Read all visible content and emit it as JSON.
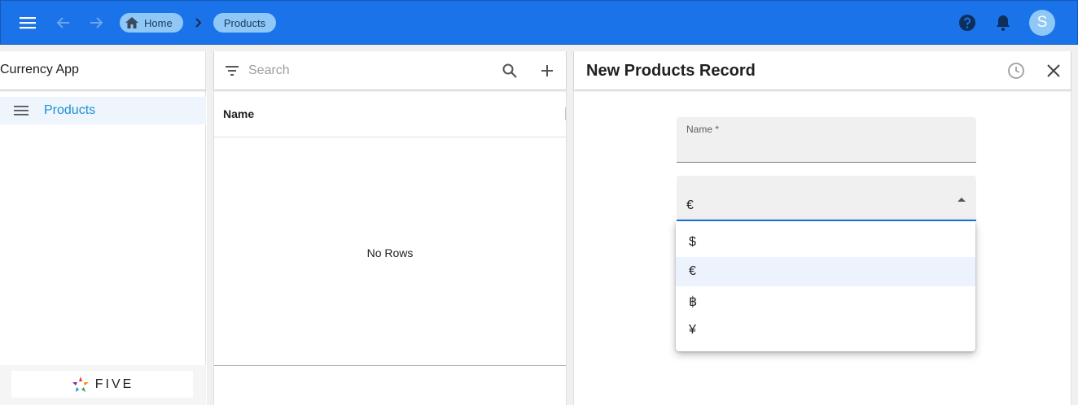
{
  "breadcrumb": {
    "home_label": "Home",
    "current_label": "Products"
  },
  "user": {
    "avatar_letter": "S"
  },
  "sidebar": {
    "app_title": "Currency App",
    "items": [
      {
        "label": "Products",
        "icon": "hamburger-list-icon"
      }
    ],
    "footer_logo_text": "FIVE"
  },
  "list": {
    "search_placeholder": "Search",
    "columns": [
      "Name"
    ],
    "empty_text": "No Rows"
  },
  "form": {
    "title": "New Products Record",
    "fields": {
      "name_label": "Name *",
      "name_value": "",
      "currency_value": "€"
    }
  },
  "dropdown": {
    "options": [
      "$",
      "€",
      "฿",
      "¥"
    ],
    "selected_index": 1
  },
  "colors": {
    "appbar": "#1a73e8",
    "accent": "#1a8fd6",
    "chip": "#8fc8f7"
  }
}
